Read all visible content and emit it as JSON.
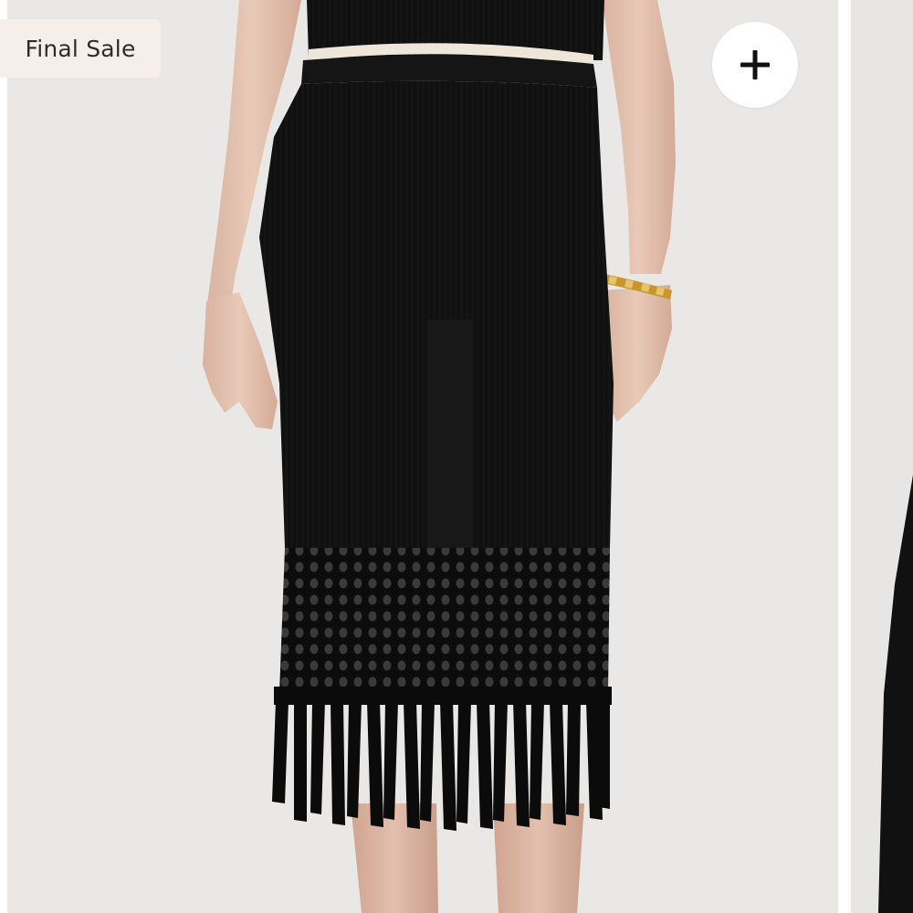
{
  "badge": {
    "label": "Final Sale"
  },
  "actions": {
    "add_icon": "plus-icon"
  },
  "colors": {
    "badge_background": "#f6efe9",
    "badge_text": "#2c2c2c",
    "photo_background": "#e9e8e7",
    "garment": "#0f0f0f",
    "button_background": "#ffffff"
  }
}
